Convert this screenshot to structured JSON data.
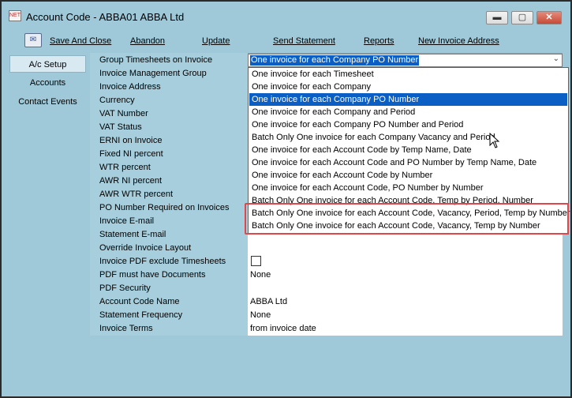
{
  "window": {
    "title": "Account Code - ABBA01 ABBA Ltd",
    "app_icon_label": "NET",
    "minimize_glyph": "▬",
    "maximize_glyph": "▢",
    "close_glyph": "✕"
  },
  "toolbar": {
    "icon_glyph": "✉",
    "save_and_close": "Save And Close",
    "abandon": "Abandon",
    "update": "Update",
    "send_statement": "Send Statement",
    "reports": "Reports",
    "new_invoice_address": "New Invoice Address"
  },
  "sidebar": {
    "items": [
      {
        "label": "A/c Setup",
        "active": true
      },
      {
        "label": "Accounts",
        "active": false
      },
      {
        "label": "Contact Events",
        "active": false
      }
    ]
  },
  "form": {
    "labels": [
      "Group Timesheets on Invoice",
      "Invoice Management Group",
      "Invoice Address",
      "Currency",
      "VAT Number",
      "VAT Status",
      "ERNI on Invoice",
      "Fixed NI percent",
      "WTR percent",
      "AWR NI percent",
      "AWR WTR percent",
      "PO Number Required on Invoices",
      "Invoice E-mail",
      "Statement E-mail",
      "Override Invoice Layout",
      "Invoice PDF exclude Timesheets",
      "PDF must have Documents",
      "PDF Security",
      "Account Code Name",
      "Statement Frequency",
      "Invoice Terms"
    ],
    "values": {
      "pdf_must_have_documents": "None",
      "account_code_name": "ABBA Ltd",
      "statement_frequency": "None",
      "invoice_terms": "from invoice date"
    },
    "invoice_pdf_exclude_timesheets_checked": false
  },
  "combo": {
    "selected": "One invoice for each Company PO Number",
    "arrow_glyph": "⌄",
    "options": [
      "One invoice for each Timesheet",
      "One invoice for each Company",
      "One invoice for each Company PO Number",
      "One invoice for each Company and Period",
      "One invoice for each Company PO Number and Period",
      "Batch Only One invoice for each Company Vacancy and Period",
      "One invoice for each Account Code by Temp Name, Date",
      "One invoice for each Account Code and PO Number by Temp Name, Date",
      "One invoice for each Account Code by Number",
      "One invoice for each Account Code, PO Number by Number",
      "Batch Only One invoice for each Account Code, Temp by Period, Number",
      "Batch Only One invoice for each Account Code, Vacancy, Period, Temp by Number",
      "Batch Only One invoice for each Account Code, Vacancy, Temp by Number"
    ],
    "selected_index": 2
  },
  "colors": {
    "window_bg": "#9fc9d9",
    "selection": "#0a5ec4",
    "highlight_box": "#e0464a"
  }
}
